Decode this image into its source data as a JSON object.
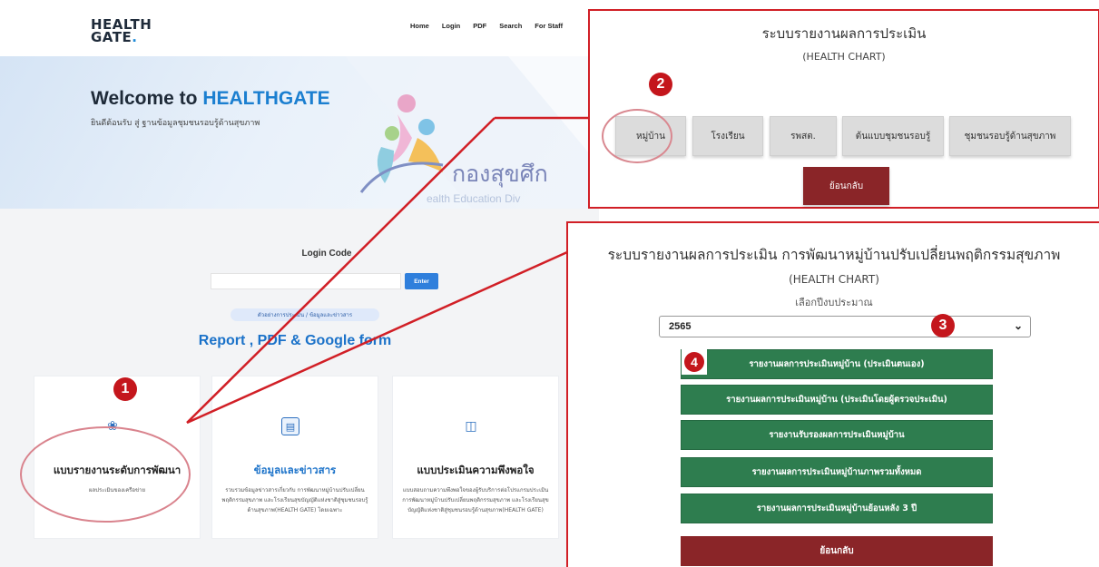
{
  "site": {
    "logo_line1": "HEALTH",
    "logo_line2": "GATE",
    "logo_dot": ".",
    "nav": [
      "Home",
      "Login",
      "PDF",
      "Search",
      "For Staff"
    ],
    "welcome_prefix": "Welcome to ",
    "welcome_highlight": "HEALTHGATE",
    "welcome_sub": "ยินดีต้อนรับ สู่ ฐานข้อมูลชุมชนรอบรู้ด้านสุขภาพ",
    "hero_brand": "กองสุขศึก",
    "hero_brand_sub": "ealth Education Div",
    "login_title": "Login Code",
    "login_input_value": "",
    "enter_label": "Enter",
    "pill_label": "ตัวอย่างการประเมิน / ข้อมูลและข่าวสาร",
    "report_heading": "Report , PDF & Google form",
    "cards": [
      {
        "icon": "dribbble-icon",
        "title": "แบบรายงานระดับการพัฒนา",
        "desc": "ผลประเมินของเครือข่าย"
      },
      {
        "icon": "newspaper-icon",
        "title": "ข้อมูลและข่าวสาร",
        "desc": "รวบรวมข้อมูลข่าวสารเกี่ยวกับ การพัฒนาหมู่บ้านปรับเปลี่ยนพฤติกรรมสุขภาพ และโรงเรียนสุขบัญญัติแห่งชาติสู่ชุมชนรอบรู้ด้านสุขภาพ(HEALTH GATE) โดยเฉพาะ"
      },
      {
        "icon": "presentation-icon",
        "title": "แบบประเมินความพึงพอใจ",
        "desc": "แบบสอบถามความพึงพอใจของผู้รับบริการต่อโปรแกรมประเมินการพัฒนาหมู่บ้านปรับเปลี่ยนพฤติกรรมสุขภาพ และโรงเรียนสุขบัญญัติแห่งชาติสู่ชุมชนรอบรู้ด้านสุขภาพ(HEALTH GATE)"
      }
    ]
  },
  "popup_top": {
    "title": "ระบบรายงานผลการประเมิน",
    "subtitle": "(HEALTH CHART)",
    "tabs": [
      "หมู่บ้าน",
      "โรงเรียน",
      "รพสต.",
      "ต้นแบบชุมชนรอบรู้",
      "ชุมชนรอบรู้ด้านสุขภาพ"
    ],
    "back_label": "ย้อนกลับ"
  },
  "popup_bottom": {
    "title": "ระบบรายงานผลการประเมิน การพัฒนาหมู่บ้านปรับเปลี่ยนพฤติกรรมสุขภาพ",
    "subtitle": "(HEALTH CHART)",
    "select_label": "เลือกปีงบประมาณ",
    "selected_year": "2565",
    "reports": [
      "รายงานผลการประเมินหมู่บ้าน (ประเมินตนเอง)",
      "รายงานผลการประเมินหมู่บ้าน (ประเมินโดยผู้ตรวจประเมิน)",
      "รายงานรับรองผลการประเมินหมู่บ้าน",
      "รายงานผลการประเมินหมู่บ้านภาพรวมทั้งหมด",
      "รายงานผลการประเมินหมู่บ้านย้อนหลัง 3 ปี"
    ],
    "back_label": "ย้อนกลับ"
  },
  "annotations": {
    "badge1": "1",
    "badge2": "2",
    "badge3": "3",
    "badge4": "4"
  },
  "colors": {
    "annotation_red": "#c4161c",
    "report_green": "#2e7d4f",
    "back_maroon": "#8a2528",
    "link_blue": "#1b72c9"
  }
}
